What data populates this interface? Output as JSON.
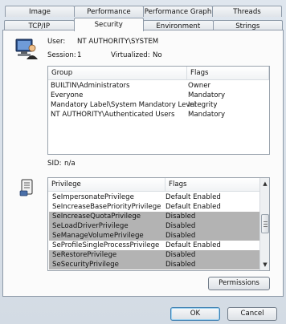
{
  "tabs": {
    "row1": [
      "Image",
      "Performance",
      "Performance Graph",
      "Threads"
    ],
    "row2": [
      "TCP/IP",
      "Security",
      "Environment",
      "Strings"
    ],
    "active": "Security"
  },
  "user": {
    "user_label": "User:",
    "user_value": "NT AUTHORITY\\SYSTEM",
    "session_label": "Session:",
    "session_value": "1",
    "virtualized_label": "Virtualized:",
    "virtualized_value": "No"
  },
  "groups": {
    "col_group": "Group",
    "col_flags": "Flags",
    "rows": [
      {
        "group": "BUILTIN\\Administrators",
        "flags": "Owner"
      },
      {
        "group": "Everyone",
        "flags": "Mandatory"
      },
      {
        "group": "Mandatory Label\\System Mandatory Level",
        "flags": "Integrity"
      },
      {
        "group": "NT AUTHORITY\\Authenticated Users",
        "flags": "Mandatory"
      }
    ]
  },
  "sid": {
    "label": "SID:",
    "value": "n/a"
  },
  "privileges": {
    "col_privilege": "Privilege",
    "col_flags": "Flags",
    "rows": [
      {
        "name": "SeImpersonatePrivilege",
        "flags": "Default Enabled",
        "selected": false
      },
      {
        "name": "SeIncreaseBasePriorityPrivilege",
        "flags": "Default Enabled",
        "selected": false
      },
      {
        "name": "SeIncreaseQuotaPrivilege",
        "flags": "Disabled",
        "selected": true
      },
      {
        "name": "SeLoadDriverPrivilege",
        "flags": "Disabled",
        "selected": true
      },
      {
        "name": "SeManageVolumePrivilege",
        "flags": "Disabled",
        "selected": true
      },
      {
        "name": "SeProfileSingleProcessPrivilege",
        "flags": "Default Enabled",
        "selected": false
      },
      {
        "name": "SeRestorePrivilege",
        "flags": "Disabled",
        "selected": true
      },
      {
        "name": "SeSecurityPrivilege",
        "flags": "Disabled",
        "selected": true
      }
    ]
  },
  "buttons": {
    "permissions": "Permissions",
    "ok": "OK",
    "cancel": "Cancel"
  }
}
